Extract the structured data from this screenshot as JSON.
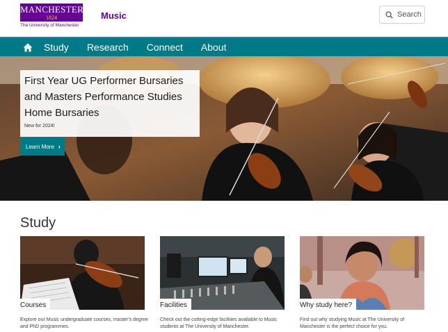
{
  "header": {
    "logo_name": "MANCHESTER",
    "logo_year": "1824",
    "logo_subtitle": "The University of Manchester",
    "site_title": "Music",
    "search_label": "Search",
    "colors": {
      "brand": "#660099",
      "accent": "#007a87"
    }
  },
  "nav": {
    "items": [
      {
        "label": "Study"
      },
      {
        "label": "Research"
      },
      {
        "label": "Connect"
      },
      {
        "label": "About"
      }
    ]
  },
  "hero": {
    "title": "First Year UG Performer Bursaries and Masters Performance Studies Home Bursaries",
    "subtitle": "New for 2024!",
    "button_label": "Learn More"
  },
  "study": {
    "heading": "Study",
    "cards": [
      {
        "label": "Courses",
        "description": "Explore our Music undergraduate courses, master's degree and PhD programmes."
      },
      {
        "label": "Facilities",
        "description": "Check out the cutting-edge facilities available to Music students at The University of Manchester."
      },
      {
        "label": "Why study here?",
        "description": "Find out why studying Music at The University of Manchester is the perfect choice for you."
      }
    ]
  }
}
